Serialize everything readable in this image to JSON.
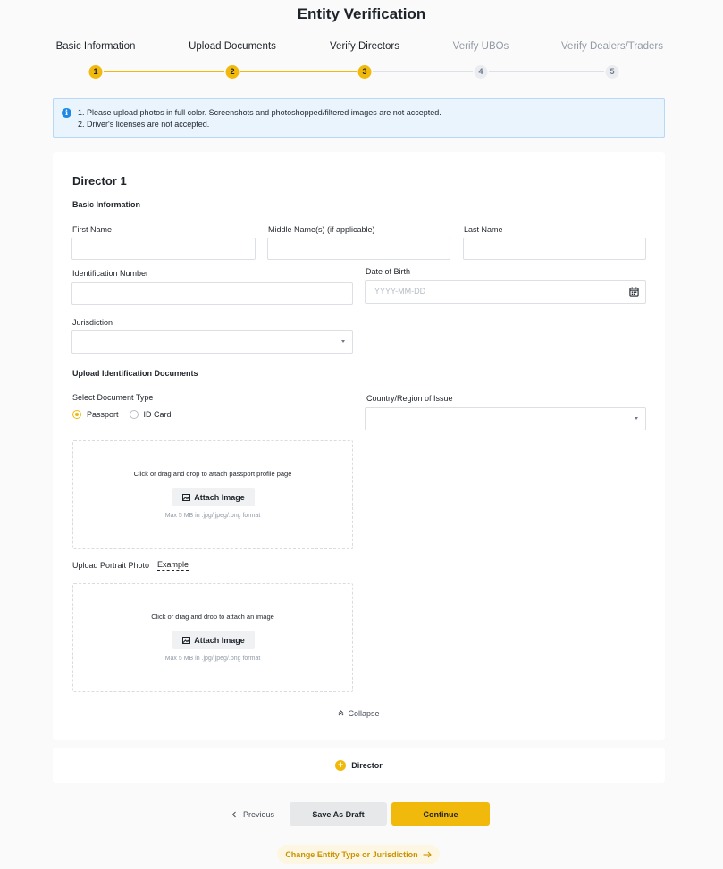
{
  "page": {
    "title": "Entity Verification"
  },
  "steps": [
    {
      "label": "Basic Information",
      "number": "1",
      "state": "done"
    },
    {
      "label": "Upload Documents",
      "number": "2",
      "state": "done"
    },
    {
      "label": "Verify Directors",
      "number": "3",
      "state": "current"
    },
    {
      "label": "Verify UBOs",
      "number": "4",
      "state": "todo"
    },
    {
      "label": "Verify Dealers/Traders",
      "number": "5",
      "state": "todo"
    }
  ],
  "notice": {
    "icon": "info-icon",
    "lines": [
      "1. Please upload photos in full color. Screenshots and photoshopped/filtered images are not accepted.",
      "2. Driver's licenses are not accepted."
    ]
  },
  "director": {
    "title": "Director 1",
    "basic_info_title": "Basic Information",
    "first_name": {
      "label": "First Name",
      "value": ""
    },
    "middle_name": {
      "label": "Middle Name(s) (if applicable)",
      "value": ""
    },
    "last_name": {
      "label": "Last Name",
      "value": ""
    },
    "id_number": {
      "label": "Identification Number",
      "value": ""
    },
    "dob": {
      "label": "Date of Birth",
      "placeholder": "YYYY-MM-DD",
      "icon": "calendar-icon"
    },
    "jurisdiction": {
      "label": "Jurisdiction",
      "value": ""
    },
    "upload_title": "Upload Identification Documents",
    "doc_type": {
      "label": "Select Document Type",
      "options": [
        "Passport",
        "ID Card"
      ],
      "selected": "Passport"
    },
    "country": {
      "label": "Country/Region of Issue",
      "value": ""
    },
    "passport_drop": {
      "text": "Click or drag and drop to attach passport profile page",
      "button": "Attach Image",
      "hint": "Max 5 MB in .jpg/.jpeg/.png format"
    },
    "portrait": {
      "label": "Upload Portrait Photo",
      "example": "Example",
      "text": "Click or drag and drop to attach an image",
      "button": "Attach Image",
      "hint": "Max 5 MB in .jpg/.jpeg/.png format"
    },
    "collapse": "Collapse"
  },
  "add_director": {
    "label": "Director"
  },
  "actions": {
    "previous": "Previous",
    "save_draft": "Save As Draft",
    "continue": "Continue",
    "change_entity": "Change Entity Type or Jurisdiction"
  },
  "colors": {
    "accent": "#f0b90b",
    "info": "#1e88e5"
  }
}
